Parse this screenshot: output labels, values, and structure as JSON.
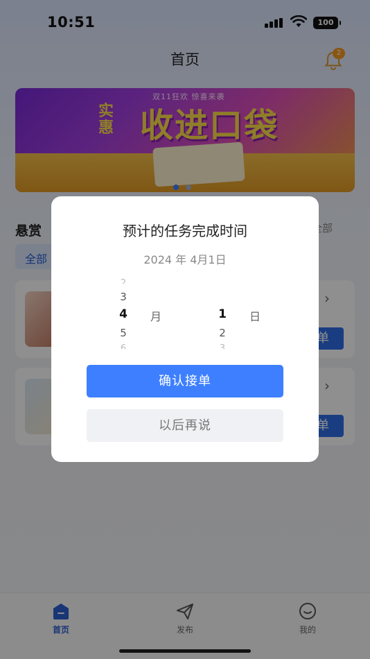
{
  "status_bar": {
    "time": "10:51",
    "battery": "100"
  },
  "header": {
    "title": "首页",
    "notification_count": "2"
  },
  "banner": {
    "subtitle": "双11狂欢 惊喜来袭",
    "headline_small": "实惠",
    "headline_big": "收进口袋",
    "slide_count": 2,
    "active_slide": 1,
    "colors": {
      "active_dot": "#3d7fff",
      "inactive_dot": "#a9b6cf"
    }
  },
  "task_section": {
    "title": "悬赏",
    "view_all": "全部",
    "filter_chip": "全部",
    "cards": [
      {
        "take_label": "单"
      },
      {
        "take_label": "单"
      }
    ]
  },
  "dialog": {
    "title": "预计的任务完成时间",
    "selected_date": "2024 年 4月1日",
    "month_picker": {
      "above": "3",
      "selected": "4",
      "below": "5",
      "unit": "月"
    },
    "day_picker": {
      "selected": "1",
      "below": "2",
      "unit": "日"
    },
    "confirm_label": "确认接单",
    "later_label": "以后再说",
    "colors": {
      "confirm": "#3d7fff",
      "later": "#f0f1f4"
    }
  },
  "tabbar": {
    "items": [
      {
        "label": "首页",
        "icon": "home-icon",
        "active": true
      },
      {
        "label": "发布",
        "icon": "send-icon",
        "active": false
      },
      {
        "label": "我的",
        "icon": "profile-icon",
        "active": false
      }
    ],
    "colors": {
      "active": "#2b5fd0",
      "inactive": "#666666"
    }
  }
}
